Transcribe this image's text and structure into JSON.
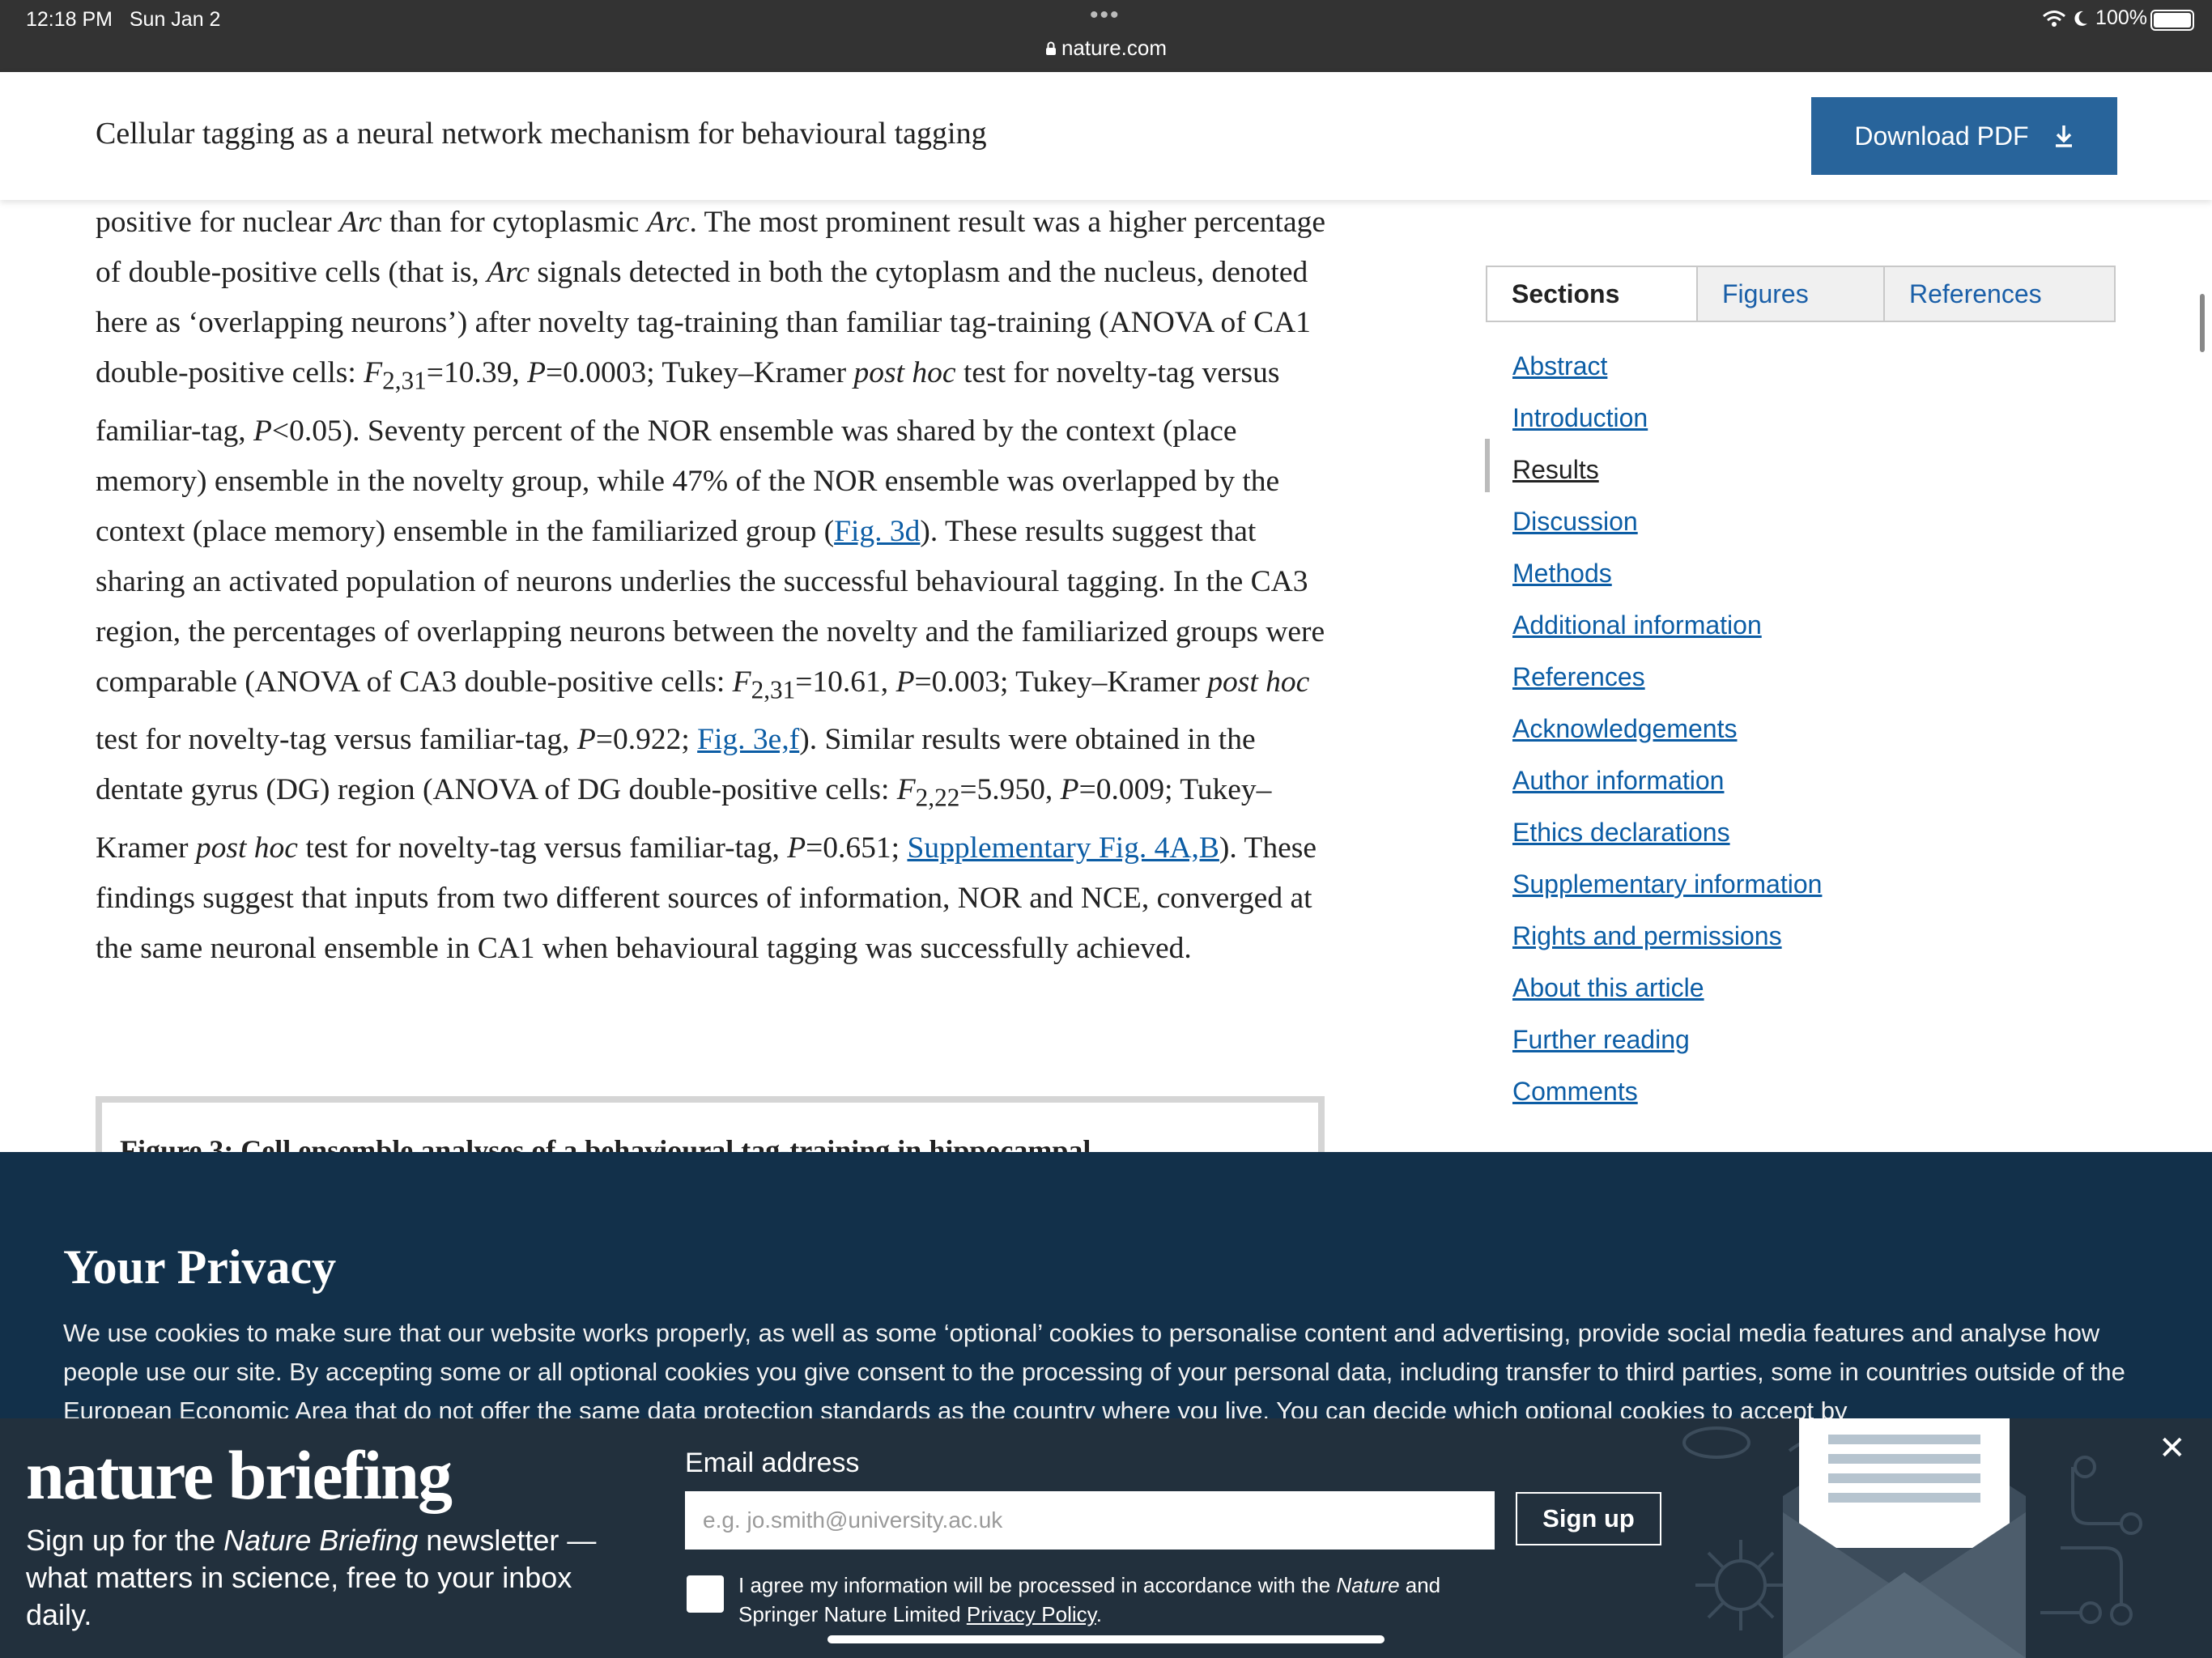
{
  "status_bar": {
    "time": "12:18 PM",
    "date": "Sun Jan 2",
    "dots": "•••",
    "url": "nature.com",
    "battery": "100%"
  },
  "header": {
    "title": "Cellular tagging as a neural network mechanism for behavioural tagging",
    "download_label": "Download PDF"
  },
  "article": {
    "s1": "positive for nuclear ",
    "arc": "Arc",
    "s2": " than for cytoplasmic ",
    "s3": ". The most prominent result was a higher percentage of double-positive cells (that is, ",
    "s4": " signals detected in both the cytoplasm and the nucleus, denoted here as ‘overlapping neurons’) after novelty tag-training than familiar tag-training (ANOVA of CA1 double-positive cells: ",
    "F": "F",
    "sub_2_31": "2,31",
    "s5": "=10.39, ",
    "P": "P",
    "s6": "=0.0003; Tukey–Kramer ",
    "post_hoc": "post hoc",
    "s7": " test for novelty-tag versus familiar-tag, ",
    "s8": "<0.05). Seventy percent of the NOR ensemble was shared by the context (place memory) ensemble in the novelty group, while 47% of the NOR ensemble was overlapped by the context (place memory) ensemble in the familiarized group (",
    "link_fig3d": "Fig. 3d",
    "s9": "). These results suggest that sharing an activated population of neurons underlies the successful behavioural tagging. In the CA3 region, the percentages of overlapping neurons between the novelty and the familiarized groups were comparable (ANOVA of CA3 double-positive cells: ",
    "s10": "=10.61, ",
    "s11": "=0.003; Tukey–Kramer ",
    "s12": " test for novelty-tag versus familiar-tag, ",
    "s13": "=0.922; ",
    "link_fig3ef": "Fig. 3e,f",
    "s14": "). Similar results were obtained in the dentate gyrus (DG) region (ANOVA of DG double-positive cells: ",
    "sub_2_22": "2,22",
    "s15": "=5.950, ",
    "s16": "=0.009; Tukey–Kramer ",
    "s17": " test for novelty-tag versus familiar-tag, ",
    "s18": "=0.651; ",
    "link_supp": "Supplementary Fig. 4A,B",
    "s19": "). These findings suggest that inputs from two different sources of information, NOR and NCE, converged at the same neuronal ensemble in CA1 when behavioural tagging was successfully achieved."
  },
  "figure_caption_cut": "Figure 3: Cell ensemble analyses of a behavioural tag-training in hippocampal",
  "sidebar": {
    "tabs": [
      "Sections",
      "Figures",
      "References"
    ],
    "items": [
      "Abstract",
      "Introduction",
      "Results",
      "Discussion",
      "Methods",
      "Additional information",
      "References",
      "Acknowledgements",
      "Author information",
      "Ethics declarations",
      "Supplementary information",
      "Rights and permissions",
      "About this article",
      "Further reading",
      "Comments"
    ],
    "current": "Results"
  },
  "privacy": {
    "title": "Your Privacy",
    "text": "We use cookies to make sure that our website works properly, as well as some ‘optional’ cookies to personalise content and advertising, provide social media features and analyse how people use our site. By accepting some or all optional cookies you give consent to the processing of your personal data, including transfer to third parties, some in countries outside of the European Economic Area that do not offer the same data protection standards as the country where you live. You can decide which optional cookies to accept by"
  },
  "briefing": {
    "logo": "nature briefing",
    "desc_1": "Sign up for the ",
    "desc_em": "Nature Briefing",
    "desc_2": " newsletter — what matters in science, free to your inbox daily.",
    "email_label": "Email address",
    "email_placeholder": "e.g. jo.smith@university.ac.uk",
    "signup": "Sign up",
    "consent_1": "I agree my information will be processed in accordance with the ",
    "consent_em": "Nature",
    "consent_2": " and Springer Nature Limited ",
    "consent_link": "Privacy Policy",
    "consent_3": ".",
    "close": "✕"
  },
  "colors": {
    "link": "#0c5da5",
    "pdf_button": "#28649b",
    "privacy_bg": "#12304a",
    "briefing_bg": "#22303d"
  }
}
